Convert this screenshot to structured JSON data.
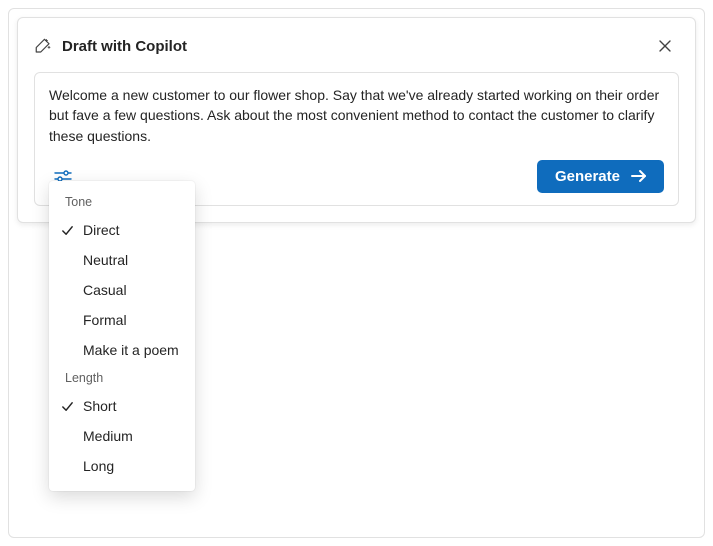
{
  "panel": {
    "title": "Draft with Copilot",
    "prompt": "Welcome a new customer to our flower shop. Say that we've already started working on their order but fave a few questions. Ask about the most convenient method to contact the customer to clarify these questions.",
    "generate_label": "Generate"
  },
  "dropdown": {
    "sections": [
      {
        "label": "Tone",
        "items": [
          {
            "label": "Direct",
            "selected": true
          },
          {
            "label": "Neutral",
            "selected": false
          },
          {
            "label": "Casual",
            "selected": false
          },
          {
            "label": "Formal",
            "selected": false
          },
          {
            "label": "Make it a poem",
            "selected": false
          }
        ]
      },
      {
        "label": "Length",
        "items": [
          {
            "label": "Short",
            "selected": true
          },
          {
            "label": "Medium",
            "selected": false
          },
          {
            "label": "Long",
            "selected": false
          }
        ]
      }
    ]
  }
}
